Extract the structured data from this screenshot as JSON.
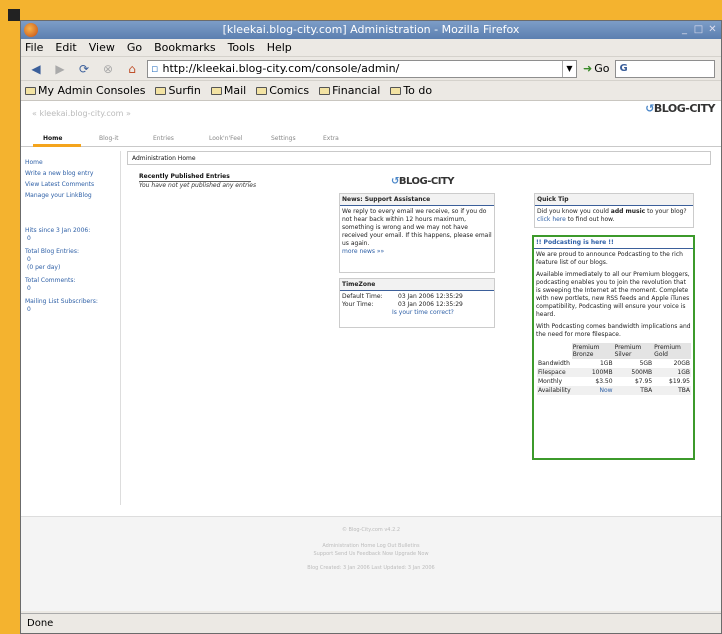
{
  "window": {
    "title": "[kleekai.blog-city.com] Administration - Mozilla Firefox"
  },
  "menu": [
    "File",
    "Edit",
    "View",
    "Go",
    "Bookmarks",
    "Tools",
    "Help"
  ],
  "nav": {
    "url": "http://kleekai.blog-city.com/console/admin/",
    "go_label": "Go",
    "search_value": "G"
  },
  "bookmarks": [
    "My Admin Consoles",
    "Surfin",
    "Mail",
    "Comics",
    "Financial",
    "To do"
  ],
  "site": {
    "url_text": "« kleekai.blog-city.com »",
    "logo": "BLOG-CITY"
  },
  "tabs": [
    "Home",
    "Blog-it",
    "Entries",
    "Look'n'Feel",
    "Settings",
    "Extra"
  ],
  "sidebar": {
    "links": [
      "Home",
      "Write a new blog entry",
      "View Latest Comments",
      "Manage your LinkBlog"
    ],
    "hits_label": "Hits since 3 Jan 2006:",
    "hits_value": "0",
    "entries_label": "Total Blog Entries:",
    "entries_value": "0",
    "entries_rate": "(0 per day)",
    "comments_label": "Total Comments:",
    "comments_value": "0",
    "subs_label": "Mailing List Subscribers:",
    "subs_value": "0"
  },
  "main": {
    "breadcrumb": "Administration Home",
    "recent_title": "Recently Published Entries",
    "recent_empty": "You have not yet published any entries",
    "news_title": "News: Support Assistance",
    "news_text": "We reply to every email we receive, so if you do not hear back within 12 hours maximum, something is wrong and we may not have received your email. If this happens, please email us again.",
    "news_more": "more news »»",
    "tz_title": "TimeZone",
    "tz_default_label": "Default Time:",
    "tz_default_value": "03 Jan 2006 12:35:29",
    "tz_your_label": "Your Time:",
    "tz_your_value": "03 Jan 2006 12:35:29",
    "tz_correct": "Is your time correct?",
    "tip_title": "Quick Tip",
    "tip_text_pre": "Did you know you could ",
    "tip_bold": "add music",
    "tip_text_post": " to your blog?",
    "tip_link": "click here",
    "tip_link_post": " to find out how.",
    "pod_title": "!! Podcasting is here !!",
    "pod_p1": "We are proud to announce Podcasting to the rich feature list of our blogs.",
    "pod_p2": "Available immediately to all our Premium bloggers, podcasting enables you to join the revolution that is sweeping the Internet at the moment. Complete with new portlets, new RSS feeds and Apple iTunes compatibility, Podcasting will ensure your voice is heard.",
    "pod_p3": "With Podcasting comes bandwidth implications and the need for more filespace.",
    "pod_table": {
      "headers": [
        "",
        "Premium Bronze",
        "Premium Silver",
        "Premium Gold"
      ],
      "rows": [
        [
          "Bandwidth",
          "1GB",
          "5GB",
          "20GB"
        ],
        [
          "Filespace",
          "100MB",
          "500MB",
          "1GB"
        ],
        [
          "Monthly",
          "$3.50",
          "$7.95",
          "$19.95"
        ],
        [
          "Availability",
          "Now",
          "TBA",
          "TBA"
        ]
      ]
    }
  },
  "footer": {
    "copyright": "© Blog-City.com v4.2.2",
    "links1": "Administration Home  Log Out  Bulletins",
    "links2": "Support  Send Us Feedback Now  Upgrade Now",
    "dates": "Blog Created: 3 Jan 2006   Last Updated: 3 Jan 2006"
  },
  "status": "Done"
}
